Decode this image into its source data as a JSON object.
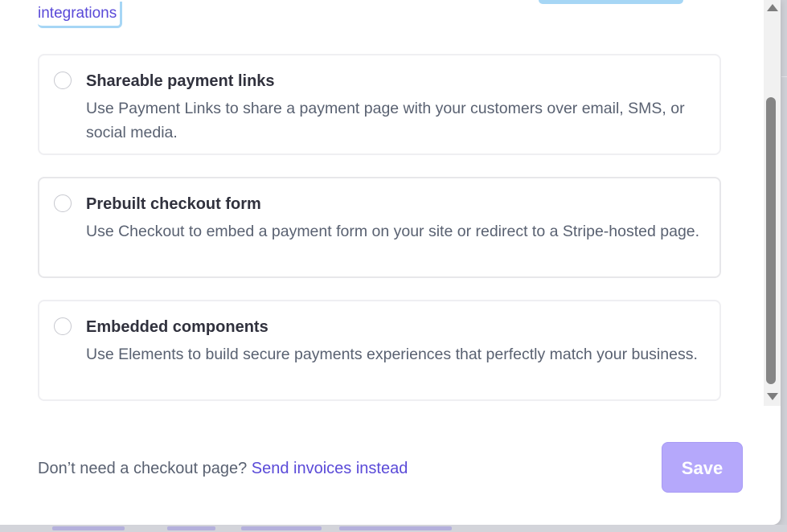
{
  "header": {
    "integrations_link": "integrations"
  },
  "options": [
    {
      "title": "Shareable payment links",
      "description": "Use Payment Links to share a payment page with your customers over email, SMS, or social media.",
      "selected": false
    },
    {
      "title": "Prebuilt checkout form",
      "description": "Use Checkout to embed a payment form on your site or redirect to a Stripe-hosted page.",
      "selected": false
    },
    {
      "title": "Embedded components",
      "description": "Use Elements to build secure payments experiences that perfectly match your business.",
      "selected": false
    }
  ],
  "footer": {
    "prompt": "Don’t need a checkout page?",
    "link": "Send invoices instead",
    "save_label": "Save"
  },
  "colors": {
    "accent": "#5a4ad8",
    "save_disabled": "#b5a8fb",
    "focus_ring": "#a6d6f5"
  }
}
